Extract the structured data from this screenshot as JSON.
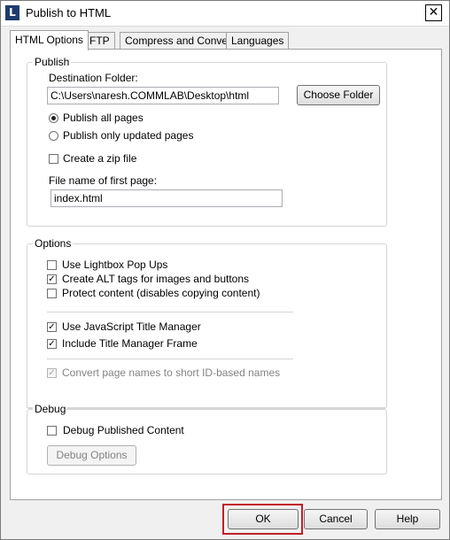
{
  "window": {
    "title": "Publish to HTML",
    "icon_letter": "L",
    "close_glyph": "✕"
  },
  "tabs": [
    {
      "label": "HTML Options",
      "active": true
    },
    {
      "label": "FTP",
      "active": false
    },
    {
      "label": "Compress and Convert",
      "active": false
    },
    {
      "label": "Languages",
      "active": false
    }
  ],
  "publish": {
    "group_label": "Publish",
    "destination_label": "Destination Folder:",
    "destination_value": "C:\\Users\\naresh.COMMLAB\\Desktop\\html",
    "choose_folder_label": "Choose Folder",
    "publish_all_label": "Publish all pages",
    "publish_updated_label": "Publish only updated pages",
    "zip_label": "Create a zip file",
    "first_page_label": "File name of first page:",
    "first_page_value": "index.html"
  },
  "options": {
    "group_label": "Options",
    "lightbox_label": "Use Lightbox Pop Ups",
    "alt_tags_label": "Create ALT tags for images and buttons",
    "protect_label": "Protect content (disables copying content)",
    "js_title_label": "Use JavaScript Title Manager",
    "title_frame_label": "Include Title Manager Frame",
    "convert_names_label": "Convert page names to short ID-based names"
  },
  "debug": {
    "group_label": "Debug",
    "debug_published_label": "Debug Published Content",
    "debug_options_label": "Debug Options"
  },
  "footer": {
    "ok_label": "OK",
    "cancel_label": "Cancel",
    "help_label": "Help"
  },
  "colors": {
    "highlight": "#c0202a",
    "app_icon": "#1f3b6f"
  },
  "icons": {
    "app": "lectora-icon",
    "close": "close-icon"
  }
}
